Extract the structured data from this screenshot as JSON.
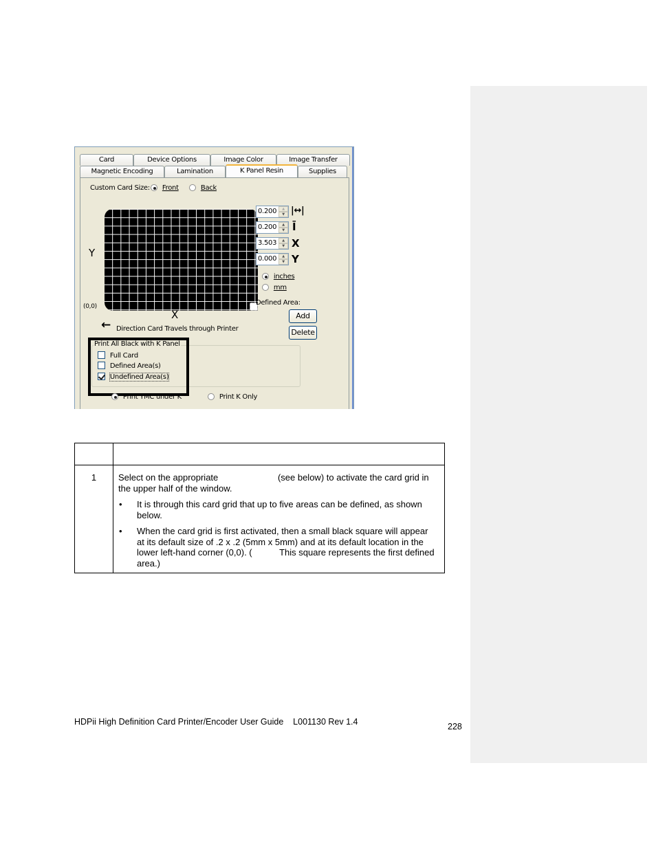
{
  "dialog": {
    "tabs_row1": [
      "Card",
      "Device Options",
      "Image Color",
      "Image Transfer"
    ],
    "tabs_row2": [
      "Magnetic Encoding",
      "Lamination",
      "K Panel Resin",
      "Supplies"
    ],
    "active_tab": "K Panel Resin",
    "custom_card_size_label": "Custom Card Size:",
    "side_options": [
      {
        "label": "Front",
        "selected": true
      },
      {
        "label": "Back",
        "selected": false
      }
    ],
    "grid": {
      "y_axis_label": "Y",
      "x_axis_label": "X",
      "origin_label": "(0,0)"
    },
    "spinners": [
      {
        "name": "width",
        "value": "0.200",
        "icon": "width-icon",
        "symbol": "↔"
      },
      {
        "name": "height",
        "value": "0.200",
        "icon": "height-icon",
        "symbol": "↕"
      },
      {
        "name": "x",
        "value": "3.503",
        "icon": "x-icon",
        "symbol": "X"
      },
      {
        "name": "y",
        "value": "0.000",
        "icon": "y-icon",
        "symbol": "Y"
      }
    ],
    "units": [
      {
        "label": "inches",
        "selected": true
      },
      {
        "label": "mm",
        "selected": false
      }
    ],
    "defined_area_label": "Defined Area:",
    "add_button": "Add",
    "delete_button": "Delete",
    "direction_label": "Direction Card Travels through Printer",
    "group_title": "Print All Black with K Panel",
    "checkboxes": [
      {
        "label": "Full Card",
        "checked": false
      },
      {
        "label": "Defined Area(s)",
        "checked": false
      },
      {
        "label": "Undefined Area(s)",
        "checked": true
      }
    ],
    "print_options": [
      {
        "label": "Print YMC under K",
        "selected": true
      },
      {
        "label": "Print K Only",
        "selected": false
      }
    ]
  },
  "table": {
    "rows": [
      {
        "step": "1",
        "text": "Select on the appropriate                        (see below) to activate the card grid in the upper half of the window.",
        "bullets": [
          "It is through this card grid that up to five areas can be defined, as shown below.",
          "When the card grid is first activated, then a small black square will appear at its default size of .2 x .2 (5mm x 5mm) and at its default location in the lower left-hand corner (0,0). (           This square represents the first defined area.)"
        ]
      }
    ]
  },
  "footer": {
    "text": "HDPii High Definition Card Printer/Encoder User Guide    L001130 Rev 1.4",
    "page": "228"
  }
}
